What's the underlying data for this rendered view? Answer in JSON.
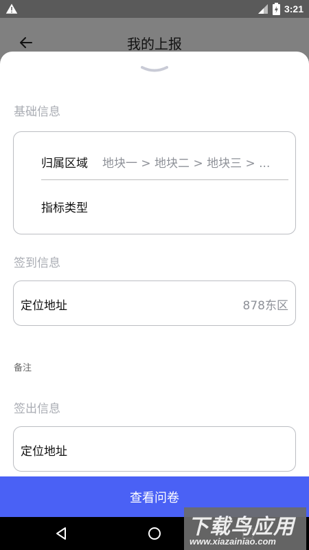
{
  "status_bar": {
    "time": "3:21",
    "icons": [
      "warning-icon",
      "signal-icon",
      "battery-icon"
    ]
  },
  "header": {
    "title": "我的上报",
    "back_icon": "arrow-left-icon"
  },
  "sections": {
    "basic_info": {
      "title": "基础信息",
      "rows": [
        {
          "label": "归属区域",
          "value": "地块一 > 地块二 > 地块三 > ..."
        },
        {
          "label": "指标类型",
          "value": ""
        }
      ]
    },
    "checkin_info": {
      "title": "签到信息",
      "location_label": "定位地址",
      "location_value": "878东区"
    },
    "remark": {
      "label": "备注"
    },
    "checkout_info": {
      "title": "签出信息",
      "location_label": "定位地址"
    }
  },
  "primary_button": {
    "label": "查看问卷"
  },
  "nav_bar": {
    "icons": [
      "back-triangle-icon",
      "home-circle-icon",
      "recents-square-icon"
    ]
  },
  "watermark": {
    "text": "下载鸟应用",
    "url": "www.xiazainiao.com"
  },
  "colors": {
    "accent": "#4a61f5",
    "muted_text": "#a9acb3",
    "border": "#bbbdc2"
  }
}
